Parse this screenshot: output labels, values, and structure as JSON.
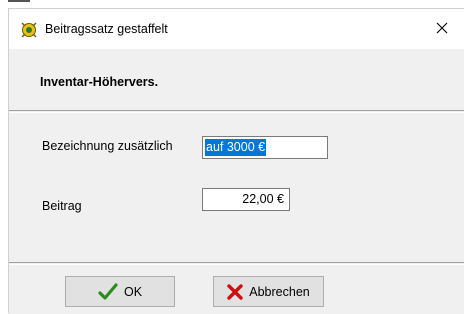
{
  "window": {
    "title": "Beitragssatz gestaffelt",
    "close_glyph": "✕"
  },
  "header": {
    "title": "Inventar-Höhervers."
  },
  "form": {
    "bezeichnung_label": "Bezeichnung zusätzlich",
    "bezeichnung_value": "auf 3000 €",
    "beitrag_label": "Beitrag",
    "beitrag_value": "22,00 €"
  },
  "buttons": {
    "ok_label": "OK",
    "cancel_label": "Abbrechen"
  },
  "icons": {
    "app": "app-icon",
    "close": "close-icon",
    "ok": "checkmark-icon",
    "cancel": "x-icon"
  },
  "colors": {
    "selection": "#0078d7",
    "check_green": "#2e8b1e",
    "cancel_red": "#d01010"
  }
}
